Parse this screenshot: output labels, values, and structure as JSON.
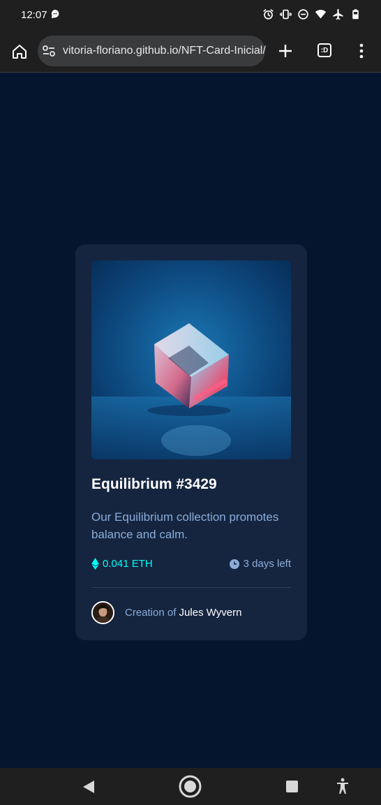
{
  "status_bar": {
    "time": "12:07",
    "left_icons": [
      "chat-bubble-icon"
    ],
    "right_icons": [
      "alarm-icon",
      "vibrate-icon",
      "do-not-disturb-icon",
      "wifi-icon",
      "airplane-icon",
      "battery-icon"
    ]
  },
  "browser": {
    "url": "vitoria-floriano.github.io/NFT-Card-Inicial/",
    "tabs_label": ":D",
    "icons": [
      "home-icon",
      "site-settings-icon",
      "new-tab-icon",
      "menu-icon"
    ]
  },
  "card": {
    "title": "Equilibrium #3429",
    "description": "Our Equilibrium collection promotes balance and calm.",
    "price": "0.041 ETH",
    "time_left": "3 days left",
    "creator_prefix": "Creation of",
    "creator_name": "Jules Wyvern"
  },
  "colors": {
    "page_bg": "#06152e",
    "card_bg": "#15253f",
    "accent_cyan": "#00fff8",
    "soft_blue": "#8bacd9",
    "white": "#ffffff"
  },
  "nav_bar": {
    "icons": [
      "back-icon",
      "home-circle-icon",
      "recents-icon",
      "accessibility-icon"
    ]
  }
}
